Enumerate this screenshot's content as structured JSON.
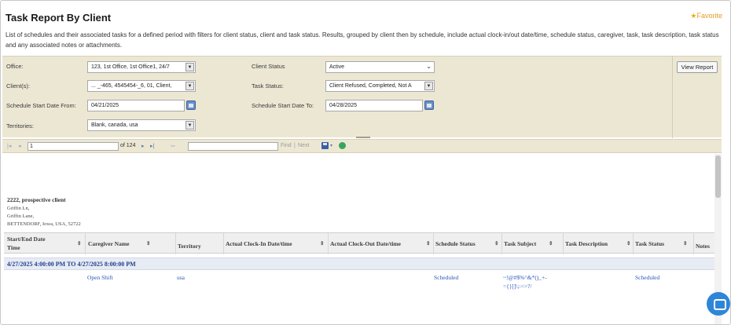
{
  "header": {
    "title": "Task Report By Client",
    "favorite_label": "Favorite",
    "description_line1": "List of schedules and their associated tasks for a defined period with filters for client status, client and task status. Results, grouped by client then by schedule, include actual clock-in/out date/time, schedule status, caregiver, task, task description, task status",
    "description_line2": "and any associated notes or attachments."
  },
  "filters": {
    "office_label": "Office:",
    "office_value": "123, 1st Office, 1st Office1, 24/7",
    "clients_label": "Client(s):",
    "clients_value": "... _-465, 4545454-_6, 01, Client,",
    "start_from_label": "Schedule Start Date From:",
    "start_from_value": "04/21/2025",
    "territories_label": "Territories:",
    "territories_value": "Blank, canada, usa",
    "client_status_label": "Client Status",
    "client_status_value": "Active",
    "task_status_label": "Task Status:",
    "task_status_value": "Client Refused, Completed, Not A",
    "start_to_label": "Schedule Start Date To:",
    "start_to_value": "04/28/2025",
    "view_report_label": "View Report"
  },
  "toolbar": {
    "page_value": "1",
    "of_pages": "of 124",
    "find_label": "Find",
    "separator": "|",
    "next_label": "Next"
  },
  "report": {
    "client_name": "2222, prospective client",
    "addr_line1": "Griffin Ln,",
    "addr_line2": "Griffin Lane,",
    "addr_line3": "BETTENDORF, Iowa, USA, 52722",
    "columns": {
      "start_end_1": "Start/End Date",
      "start_end_2": "Time",
      "caregiver": "Caregiver Name",
      "territory": "Territory",
      "clock_in": "Actual Clock-In Date/time",
      "clock_out": "Actual Clock-Out Date/time",
      "schedule_status": "Schedule Status",
      "task_subject": "Task Subject",
      "task_description": "Task Description",
      "task_status": "Task Status",
      "notes": "Notes"
    },
    "group_row": "4/27/2025 4:00:00 PM  TO  4/27/2025 8:00:00 PM",
    "row": {
      "caregiver": "Open Shift",
      "territory": "usa",
      "schedule_status": "Scheduled",
      "task_subject_1": "~!@#$%^&*()_+-",
      "task_subject_2": "={}[]\\;:<>?/",
      "task_status": "Scheduled"
    }
  },
  "icons": {
    "first_page": "first-page-icon",
    "prev_page": "prev-page-icon",
    "next_page": "next-page-icon",
    "last_page": "last-page-icon",
    "back": "back-icon",
    "export": "save-export-icon",
    "refresh": "refresh-icon",
    "calendar": "calendar-icon",
    "chat": "chat-icon",
    "star": "star-icon"
  },
  "colors": {
    "filter_panel": "#ece7d3",
    "link_blue": "#2a56b8",
    "group_row": "#e7ebf4",
    "favorite": "#e59b1f"
  }
}
